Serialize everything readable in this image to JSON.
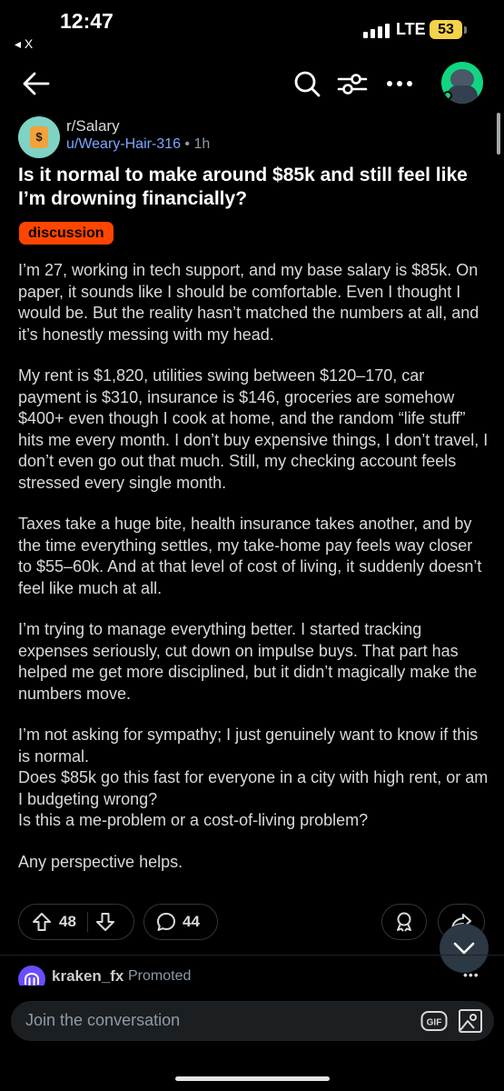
{
  "status_bar": {
    "time": "12:47",
    "back_label": "◂ X",
    "network": "LTE",
    "battery": "53"
  },
  "nav": {
    "back_icon": "arrow-left-icon",
    "search_icon": "search-icon",
    "filter_icon": "sort-filter-icon",
    "more_icon": "more-horizontal-icon"
  },
  "post": {
    "subreddit": "r/Salary",
    "author": "u/Weary-Hair-316",
    "separator": "•",
    "age": "1h",
    "title": "Is it normal to make around $85k and still feel like I’m drowning financially?",
    "flair": "discussion",
    "paragraphs": [
      "I’m 27, working in tech support, and my base salary is $85k. On paper, it sounds like I should be comfortable. Even I thought I would be. But the reality hasn’t matched the numbers at all, and it’s honestly messing with my head.",
      "My rent is $1,820, utilities swing between $120–170, car payment is $310, insurance is $146, groceries are somehow $400+ even though I cook at home, and the random “life stuff” hits me every month. I don’t buy expensive things, I don’t travel, I don’t even go out that much. Still, my checking account feels stressed every single month.",
      "Taxes take a huge bite, health insurance takes another, and by the time everything settles, my take-home pay feels way closer to $55–60k. And at that level of cost of living, it suddenly doesn’t feel like much at all.",
      "I’m trying to manage everything better. I started tracking expenses seriously, cut down on impulse buys. That part has helped me get more disciplined, but it didn’t magically make the numbers move.",
      "I’m not asking for sympathy; I just genuinely want to know if this is normal.\nDoes $85k go this fast for everyone in a city with high rent, or am I budgeting wrong?\nIs this a me-problem or a cost-of-living problem?",
      "Any perspective helps."
    ],
    "upvotes": "48",
    "comments": "44"
  },
  "promoted": {
    "user": "kraken_fx",
    "tag": "Promoted",
    "more": "•••"
  },
  "composer": {
    "placeholder": "Join the conversation",
    "gif_label": "GIF"
  },
  "colors": {
    "background": "#000000",
    "flair": "#ff4500",
    "username": "#7ba7ff",
    "avatar_green": "#11d681"
  }
}
